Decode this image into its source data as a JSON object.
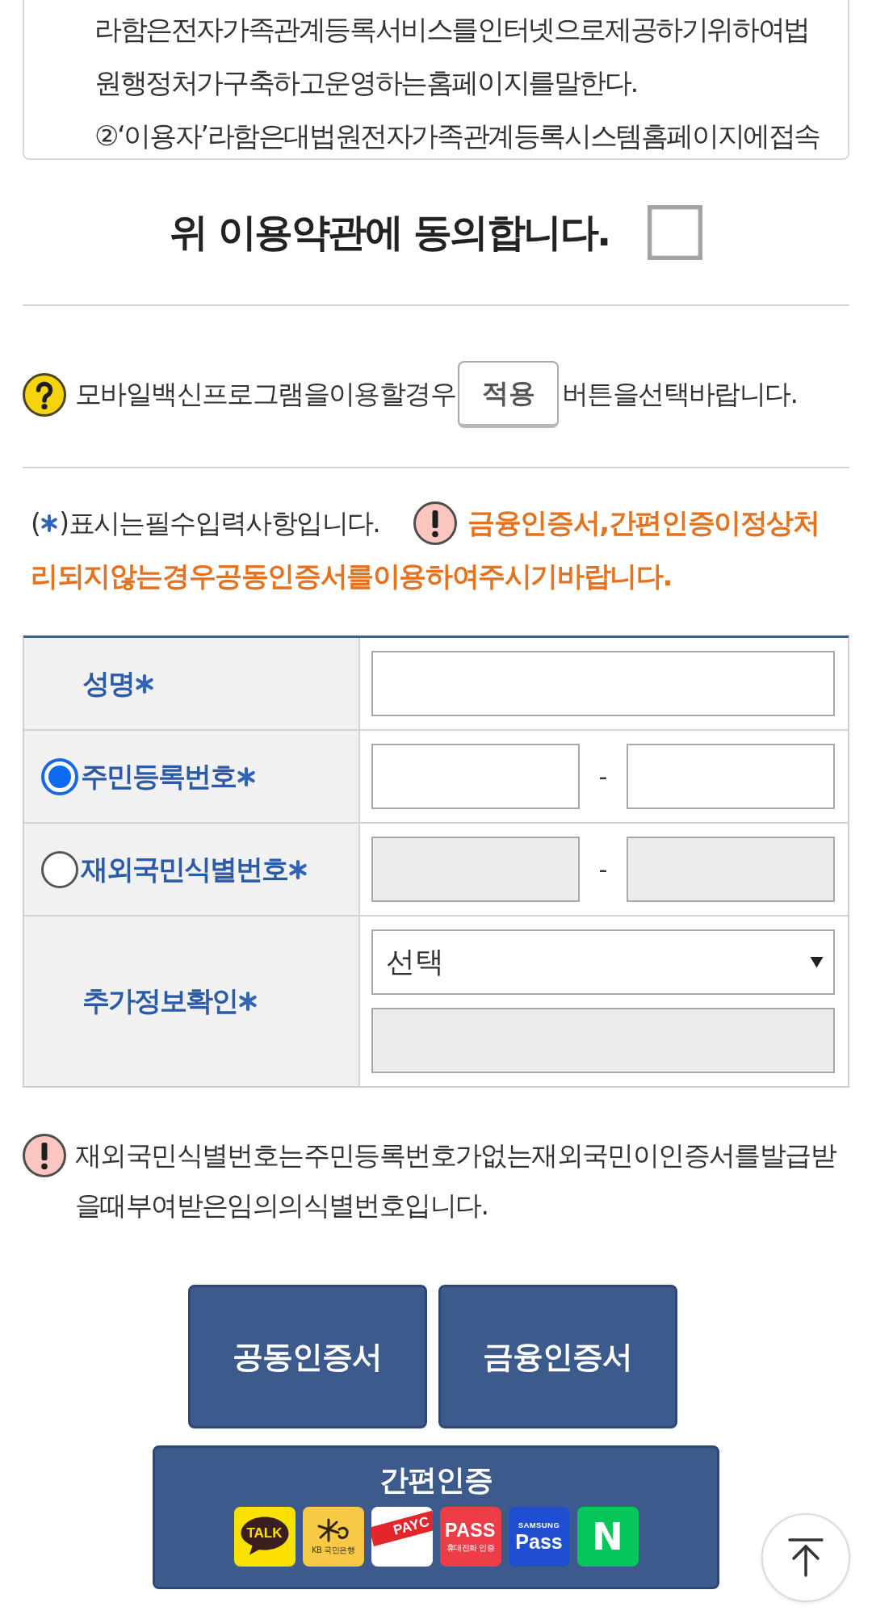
{
  "terms": {
    "paragraphs": [
      "라함은전자가족관계등록서비스를인터넷으로제공하기위하여법원행정처가구축하고운영하는홈페이지를말한다.",
      "②‘이용자’라함은대법원전자가족관계등록시스템홈페이지에접속"
    ]
  },
  "agreement": {
    "label": "위 이용약관에 동의합니다.",
    "checked": false
  },
  "vaccine_notice": {
    "before": "모바일백신프로그램을이용할경우",
    "button": "적용",
    "after": "버튼을선택바랍니다."
  },
  "required_note": {
    "open": "(",
    "close": ")표시는필수입력사항입니다.",
    "warning_lines": [
      "금융인증서,간편인증이정상처",
      "리되지않는경우공동인증서를이용하여주시기바랍니다."
    ]
  },
  "form": {
    "rows": [
      {
        "kind": "plain",
        "label": "성명",
        "required": true,
        "fields": [
          {
            "kind": "input",
            "disabled": false
          }
        ]
      },
      {
        "kind": "radio",
        "label": "주민등록번호",
        "selected": true,
        "required": true,
        "separator": "-",
        "fields": [
          {
            "kind": "input",
            "disabled": false
          },
          {
            "kind": "input",
            "disabled": false
          }
        ]
      },
      {
        "kind": "radio",
        "label": "재외국민식별번호",
        "selected": false,
        "required": true,
        "separator": "-",
        "fields": [
          {
            "kind": "input",
            "disabled": true
          },
          {
            "kind": "input",
            "disabled": true
          }
        ]
      },
      {
        "kind": "plain",
        "label": "추가정보확인",
        "required": true,
        "fields": [
          {
            "kind": "select",
            "value": "선택"
          },
          {
            "kind": "input",
            "disabled": true
          }
        ]
      }
    ]
  },
  "notice": "재외국민식별번호는주민등록번호가없는재외국민이인증서를발급받을때부여받은임의의식별번호입니다.",
  "buttons": [
    "공동인증서",
    "금융인증서"
  ],
  "simple_auth": {
    "title": "간편인증",
    "providers": [
      {
        "kind": "talk",
        "texts": [
          "TALK"
        ]
      },
      {
        "kind": "kb",
        "texts": [
          "KB 국민은행"
        ]
      },
      {
        "kind": "payco",
        "texts": [
          "PAYC"
        ]
      },
      {
        "kind": "pass",
        "texts": [
          "PASS",
          "휴대전화 인증"
        ]
      },
      {
        "kind": "samsung",
        "texts": [
          "SAMSUNG",
          "Pass"
        ]
      },
      {
        "kind": "naver",
        "texts": [
          "N"
        ]
      }
    ]
  }
}
